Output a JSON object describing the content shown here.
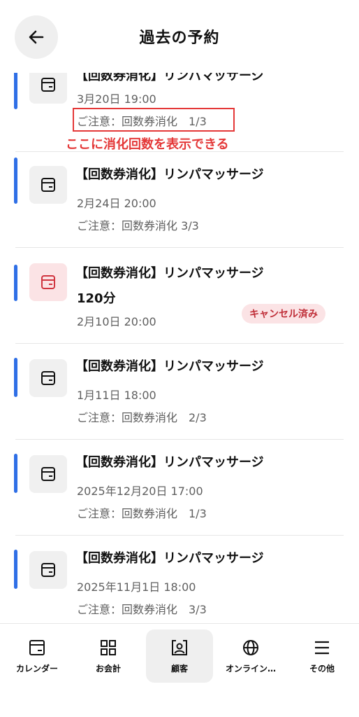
{
  "header": {
    "title": "過去の予約",
    "back_icon": "arrow-left-icon"
  },
  "reservations": [
    {
      "title": "【回数券消化】リンパマッサージ",
      "date": "3月20日 19:00",
      "note": "ご注意：回数券消化　1/3",
      "annotation": "ここに消化回数を表示できる",
      "icon": "calendar-icon"
    },
    {
      "title": "【回数券消化】リンパマッサージ",
      "date": "2月24日 20:00",
      "note": "ご注意：回数券消化 3/3",
      "icon": "calendar-icon"
    },
    {
      "title": "【回数券消化】リンパマッサージ",
      "duration": "120分",
      "date": "2月10日 20:00",
      "status": "キャンセル済み",
      "icon": "calendar-icon"
    },
    {
      "title": "【回数券消化】リンパマッサージ",
      "date": "1月11日 18:00",
      "note": "ご注意：回数券消化　2/3",
      "icon": "calendar-icon"
    },
    {
      "title": "【回数券消化】リンパマッサージ",
      "date": "2025年12月20日 17:00",
      "note": "ご注意：回数券消化　1/3",
      "icon": "calendar-icon"
    },
    {
      "title": "【回数券消化】リンパマッサージ",
      "date": "2025年11月1日 18:00",
      "note": "ご注意：回数券消化　3/3",
      "icon": "calendar-icon"
    }
  ],
  "nav": [
    {
      "label": "カレンダー",
      "icon": "calendar-icon"
    },
    {
      "label": "お会計",
      "icon": "grid-icon"
    },
    {
      "label": "顧客",
      "icon": "customer-card-icon",
      "active": true
    },
    {
      "label": "オンライン…",
      "icon": "globe-icon"
    },
    {
      "label": "その他",
      "icon": "menu-icon"
    }
  ],
  "colors": {
    "accent": "#2f6fe6",
    "annotation": "#e43838",
    "cancel_badge_bg": "#fbe3e5",
    "cancel_badge_text": "#c0303a"
  }
}
